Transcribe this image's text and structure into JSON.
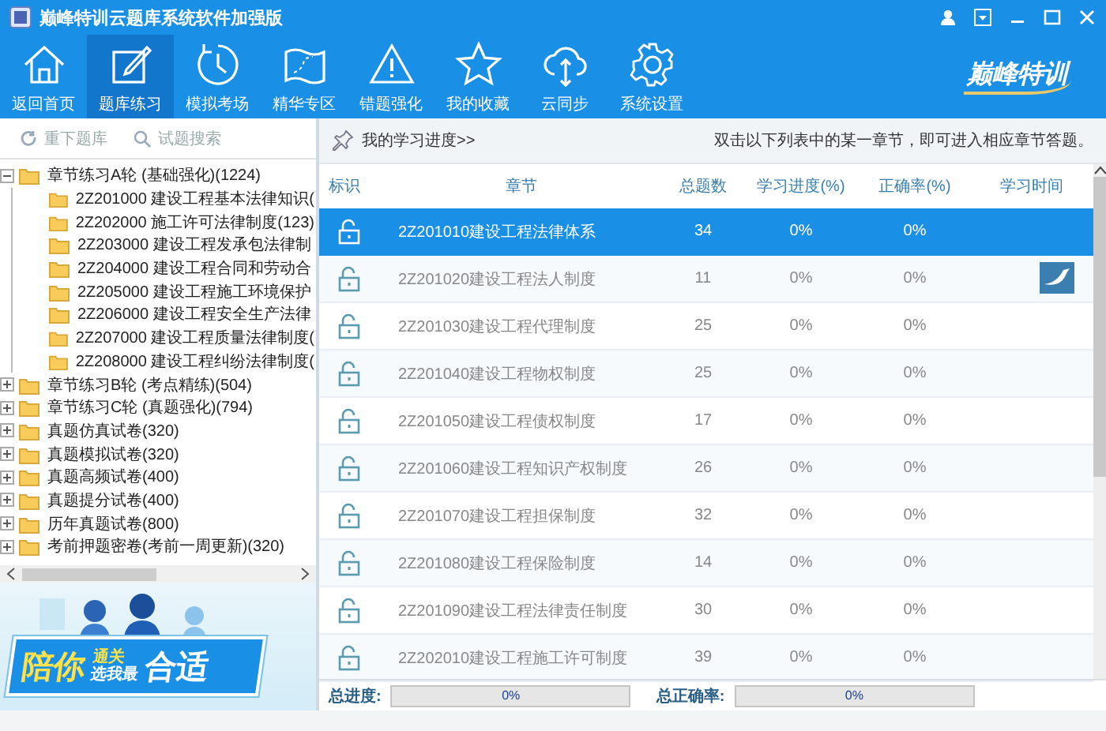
{
  "window": {
    "title": "巅峰特训云题库系统软件加强版"
  },
  "nav": [
    {
      "label": "返回首页",
      "selected": false
    },
    {
      "label": "题库练习",
      "selected": true
    },
    {
      "label": "模拟考场",
      "selected": false
    },
    {
      "label": "精华专区",
      "selected": false
    },
    {
      "label": "错题强化",
      "selected": false
    },
    {
      "label": "我的收藏",
      "selected": false
    },
    {
      "label": "云同步",
      "selected": false
    },
    {
      "label": "系统设置",
      "selected": false
    }
  ],
  "logo": "巅峰特训",
  "sidebar": {
    "tools": [
      "重下题库",
      "试题搜索"
    ],
    "tree": [
      {
        "label": "章节练习A轮  (基础强化)(1224)",
        "expanded": true,
        "children": [
          {
            "label": "2Z201000 建设工程基本法律知识("
          },
          {
            "label": "2Z202000 施工许可法律制度(123)"
          },
          {
            "label": "2Z203000 建设工程发承包法律制"
          },
          {
            "label": "2Z204000 建设工程合同和劳动合"
          },
          {
            "label": "2Z205000 建设工程施工环境保护"
          },
          {
            "label": "2Z206000 建设工程安全生产法律"
          },
          {
            "label": "2Z207000 建设工程质量法律制度("
          },
          {
            "label": "2Z208000 建设工程纠纷法律制度("
          }
        ]
      },
      {
        "label": "章节练习B轮  (考点精练)(504)",
        "expanded": false
      },
      {
        "label": "章节练习C轮  (真题强化)(794)",
        "expanded": false
      },
      {
        "label": "真题仿真试卷(320)",
        "expanded": false
      },
      {
        "label": "真题模拟试卷(320)",
        "expanded": false
      },
      {
        "label": "真题高频试卷(400)",
        "expanded": false
      },
      {
        "label": "真题提分试卷(400)",
        "expanded": false
      },
      {
        "label": "历年真题试卷(800)",
        "expanded": false
      },
      {
        "label": "考前押题密卷(考前一周更新)(320)",
        "expanded": false
      }
    ],
    "banner": [
      "陪你",
      "通关",
      "选我最",
      "合适"
    ]
  },
  "progress_header": {
    "title": "我的学习进度>>",
    "hint": "双击以下列表中的某一章节，即可进入相应章节答题。"
  },
  "table": {
    "columns": [
      "标识",
      "章节",
      "总题数",
      "学习进度(%)",
      "正确率(%)",
      "学习时间"
    ],
    "rows": [
      {
        "chapter": "2Z201010建设工程法律体系",
        "total": "34",
        "progress": "0%",
        "accuracy": "0%",
        "selected": true
      },
      {
        "chapter": "2Z201020建设工程法人制度",
        "total": "11",
        "progress": "0%",
        "accuracy": "0%",
        "selected": false
      },
      {
        "chapter": "2Z201030建设工程代理制度",
        "total": "25",
        "progress": "0%",
        "accuracy": "0%",
        "selected": false
      },
      {
        "chapter": "2Z201040建设工程物权制度",
        "total": "25",
        "progress": "0%",
        "accuracy": "0%",
        "selected": false
      },
      {
        "chapter": "2Z201050建设工程债权制度",
        "total": "17",
        "progress": "0%",
        "accuracy": "0%",
        "selected": false
      },
      {
        "chapter": "2Z201060建设工程知识产权制度",
        "total": "26",
        "progress": "0%",
        "accuracy": "0%",
        "selected": false
      },
      {
        "chapter": "2Z201070建设工程担保制度",
        "total": "32",
        "progress": "0%",
        "accuracy": "0%",
        "selected": false
      },
      {
        "chapter": "2Z201080建设工程保险制度",
        "total": "14",
        "progress": "0%",
        "accuracy": "0%",
        "selected": false
      },
      {
        "chapter": "2Z201090建设工程法律责任制度",
        "total": "30",
        "progress": "0%",
        "accuracy": "0%",
        "selected": false
      },
      {
        "chapter": "2Z202010建设工程施工许可制度",
        "total": "39",
        "progress": "0%",
        "accuracy": "0%",
        "selected": false
      }
    ]
  },
  "footer": [
    {
      "label": "总进度:",
      "reading": "0%",
      "level": 0
    },
    {
      "label": "总正确率:",
      "reading": "0%",
      "level": 0
    }
  ]
}
